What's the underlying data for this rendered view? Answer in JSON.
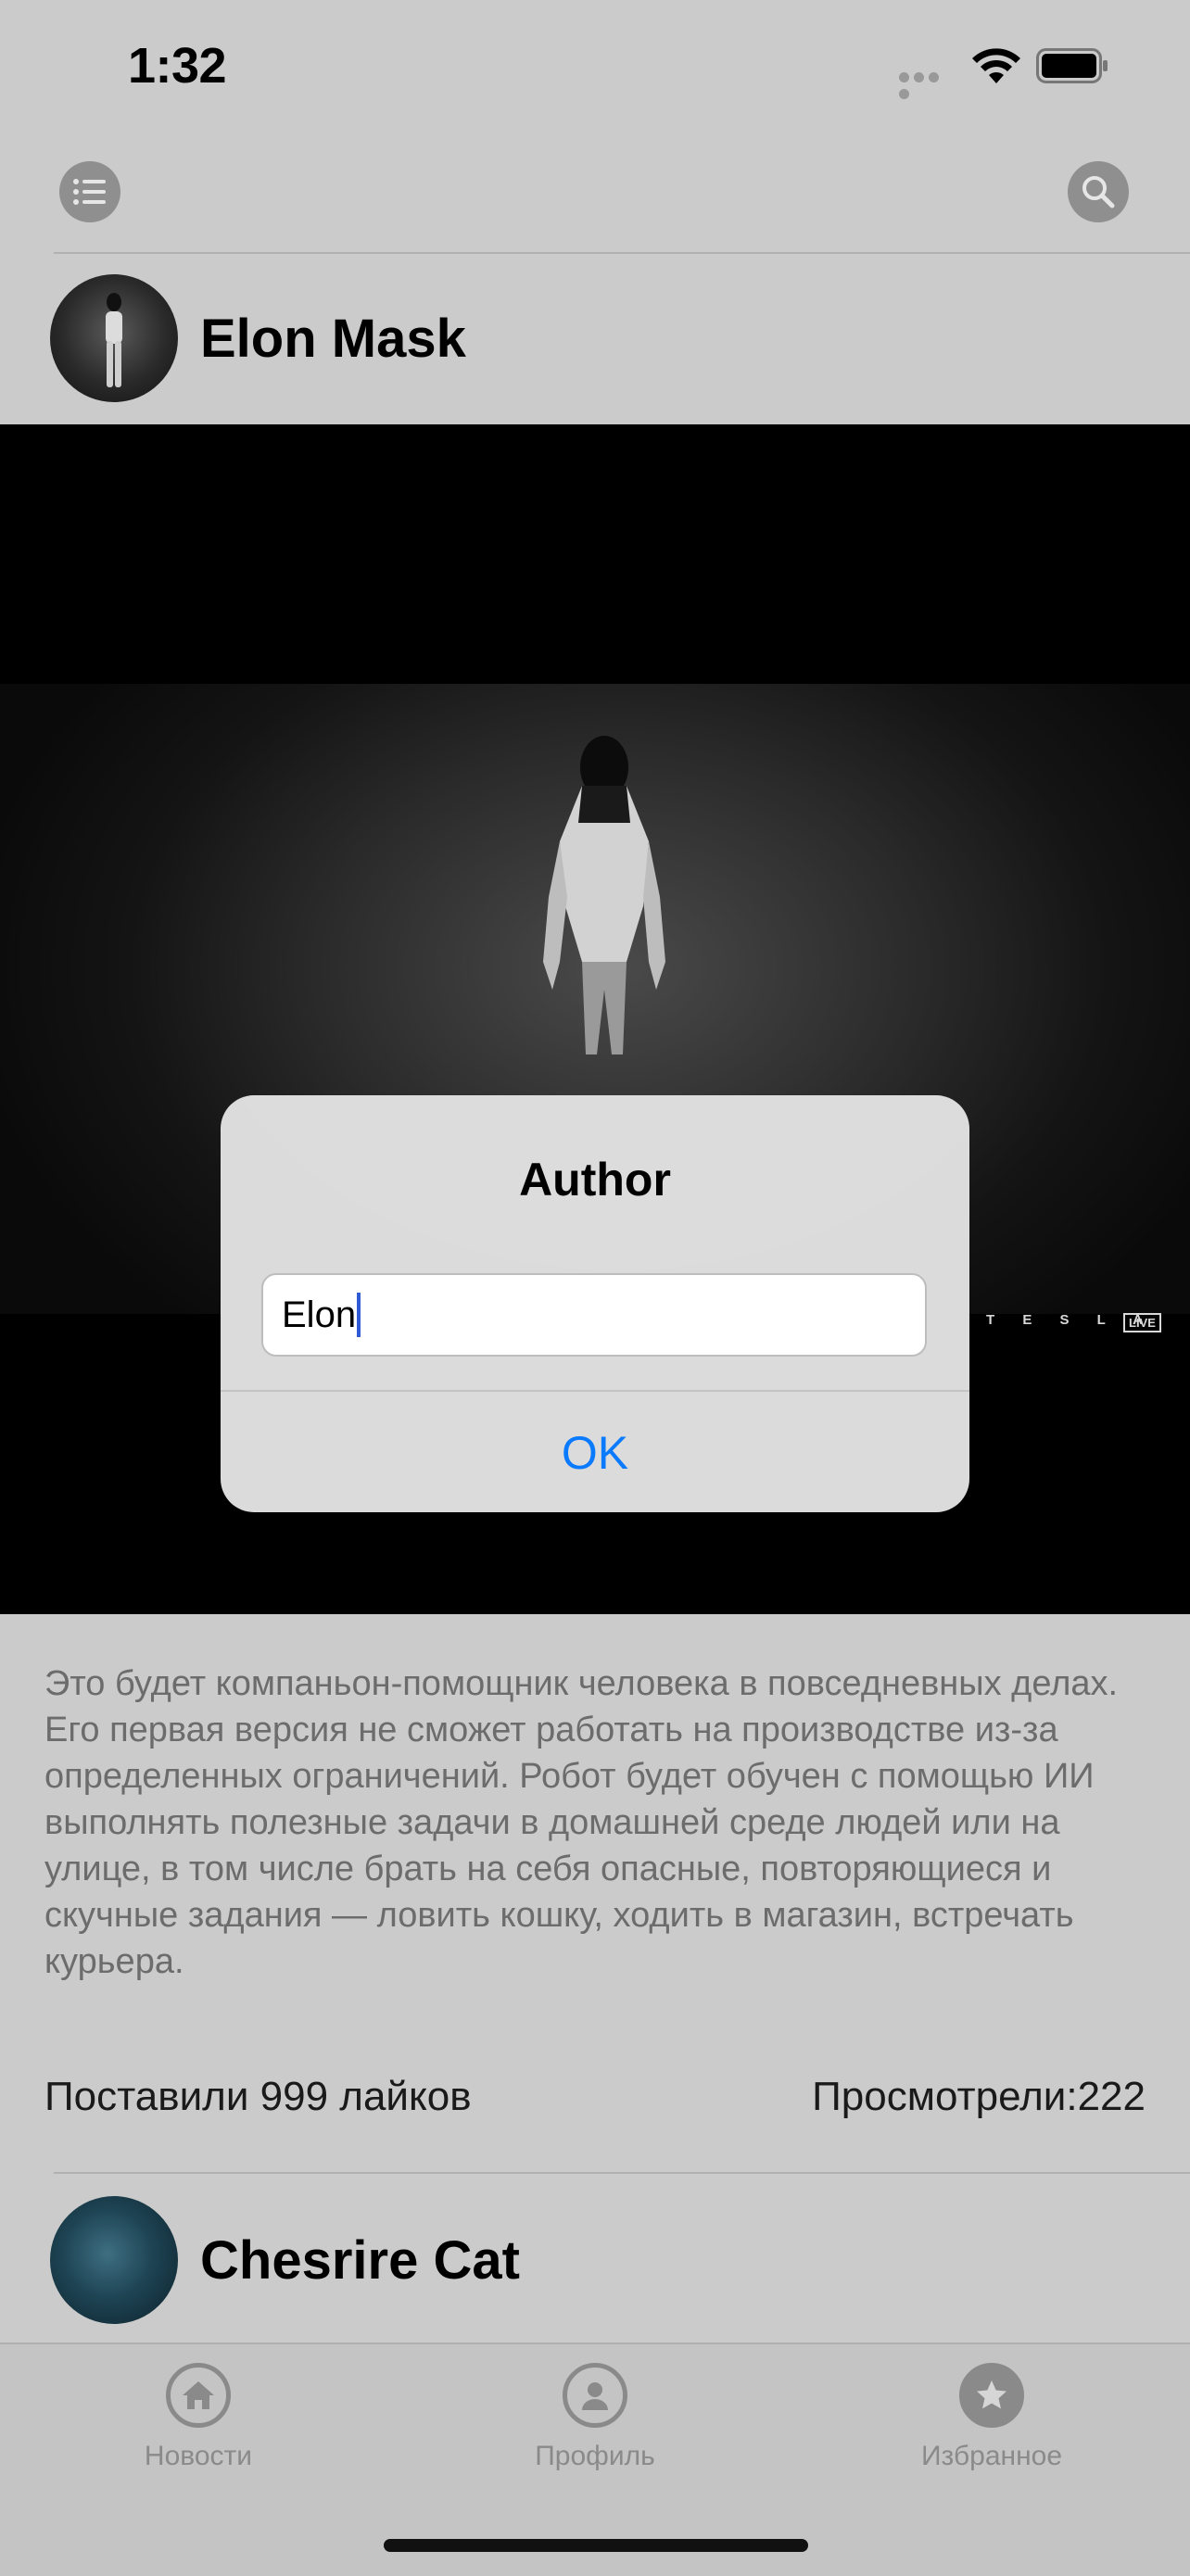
{
  "status_bar": {
    "time": "1:32"
  },
  "posts": [
    {
      "author": "Elon Mask",
      "description": "Это будет компаньон-помощник человека в повседневных делах. Его первая версия не сможет работать на производстве из-за определенных ограничений. Робот будет обучен с помощью ИИ выполнять полезные задачи в домашней среде людей или на улице, в том числе брать на себя опасные, повторяющиеся и скучные задания — ловить кошку, ходить в магазин, встречать курьера.",
      "likes": "Поставили 999 лайков",
      "views": "Просмотрели:222",
      "image_logo": "T E S L A",
      "image_badge": "LIVE"
    },
    {
      "author": "Chesrire Cat"
    }
  ],
  "alert": {
    "title": "Author",
    "input_value": "Elon",
    "ok_label": "OK"
  },
  "tabbar": {
    "items": [
      {
        "label": "Новости",
        "icon": "home-icon"
      },
      {
        "label": "Профиль",
        "icon": "person-icon"
      },
      {
        "label": "Избранное",
        "icon": "star-icon"
      }
    ]
  },
  "colors": {
    "accent": "#0a7aff",
    "background": "#cbcbcb",
    "tab_inactive": "#8a8a8a"
  }
}
